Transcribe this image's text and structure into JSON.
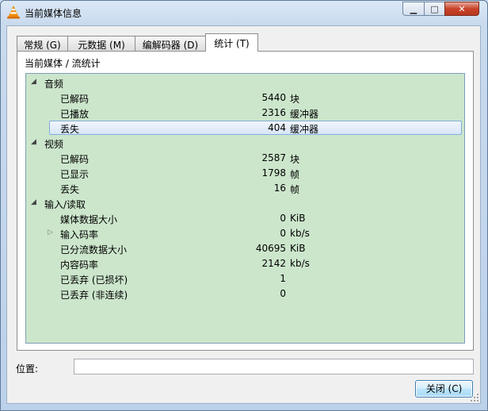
{
  "window": {
    "title": "当前媒体信息"
  },
  "tabs": [
    {
      "label": "常规 (G)"
    },
    {
      "label": "元数据 (M)"
    },
    {
      "label": "编解码器 (D)"
    },
    {
      "label": "统计 (T)",
      "active": true
    }
  ],
  "panel": {
    "path": "当前媒体 / 流统计"
  },
  "stats": {
    "audio": {
      "label": "音频",
      "rows": [
        {
          "label": "已解码",
          "value": "5440",
          "unit": "块"
        },
        {
          "label": "已播放",
          "value": "2316",
          "unit": "缓冲器"
        },
        {
          "label": "丢失",
          "value": "404",
          "unit": "缓冲器",
          "selected": true
        }
      ]
    },
    "video": {
      "label": "视频",
      "rows": [
        {
          "label": "已解码",
          "value": "2587",
          "unit": "块"
        },
        {
          "label": "已显示",
          "value": "1798",
          "unit": "帧"
        },
        {
          "label": "丢失",
          "value": "16",
          "unit": "帧"
        }
      ]
    },
    "input": {
      "label": "输入/读取",
      "rows": [
        {
          "label": "媒体数据大小",
          "value": "0",
          "unit": "KiB"
        },
        {
          "label": "输入码率",
          "value": "0",
          "unit": "kb/s",
          "expandable": true
        },
        {
          "label": "已分流数据大小",
          "value": "40695",
          "unit": "KiB"
        },
        {
          "label": "内容码率",
          "value": "2142",
          "unit": "kb/s"
        },
        {
          "label": "已丢弃 (已损坏)",
          "value": "1",
          "unit": ""
        },
        {
          "label": "已丢弃 (非连续)",
          "value": "0",
          "unit": ""
        }
      ]
    }
  },
  "location": {
    "label": "位置:",
    "value": ""
  },
  "buttons": {
    "close": "关闭 (C)"
  },
  "colors": {
    "tree_bg": "#cce6cc",
    "selection_border": "#84acdd",
    "close_button_border": "#3c7fb1"
  }
}
